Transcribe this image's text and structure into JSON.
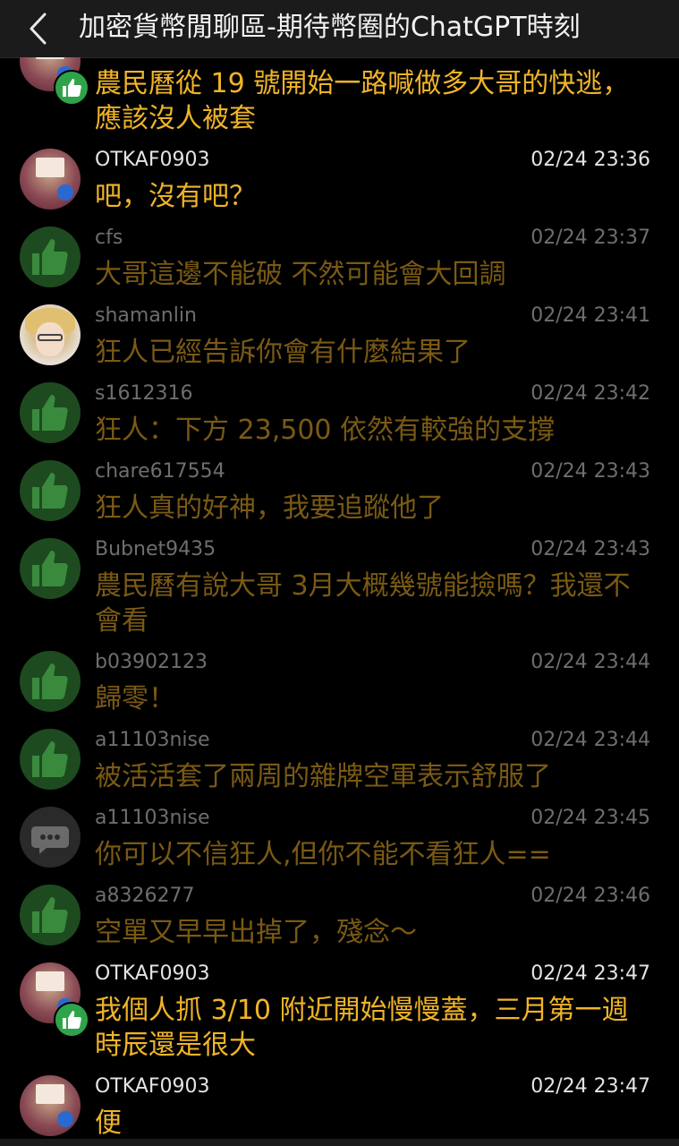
{
  "header": {
    "title": "加密貨幣閒聊區-期待幣圈的ChatGPT時刻",
    "back_icon": "chevron-left-icon"
  },
  "messages": [
    {
      "user": "",
      "time": "",
      "text": "農民曆從 19 號開始一路喊做多大哥的快逃，應該沒人被套",
      "avatar": "user-photo",
      "badge": "like-badge",
      "style": "bright"
    },
    {
      "user": "OTKAF0903",
      "time": "02/24 23:36",
      "text": "吧，沒有吧？",
      "avatar": "user-photo",
      "style": "bright"
    },
    {
      "user": "cfs",
      "time": "02/24 23:37",
      "text": "大哥這邊不能破 不然可能會大回調",
      "avatar": "like-icon",
      "style": "dim"
    },
    {
      "user": "shamanlin",
      "time": "02/24 23:41",
      "text": "狂人已經告訴你會有什麼結果了",
      "avatar": "user-photo",
      "style": "dim"
    },
    {
      "user": "s1612316",
      "time": "02/24 23:42",
      "text": "狂人：下方 23,500 依然有較強的支撐",
      "avatar": "like-icon",
      "style": "dim"
    },
    {
      "user": "chare617554",
      "time": "02/24 23:43",
      "text": "狂人真的好神，我要追蹤他了",
      "avatar": "like-icon",
      "style": "dim"
    },
    {
      "user": "Bubnet9435",
      "time": "02/24 23:43",
      "text": "農民曆有說大哥 3月大概幾號能撿嗎？我還不會看",
      "avatar": "like-icon",
      "style": "dim"
    },
    {
      "user": "b03902123",
      "time": "02/24 23:44",
      "text": "歸零！",
      "avatar": "like-icon",
      "style": "dim"
    },
    {
      "user": "a11103nise",
      "time": "02/24 23:44",
      "text": "被活活套了兩周的雜牌空軍表示舒服了",
      "avatar": "like-icon",
      "style": "dim"
    },
    {
      "user": "a11103nise",
      "time": "02/24 23:45",
      "text": "你可以不信狂人,但你不能不看狂人==",
      "avatar": "comment-icon",
      "style": "dim"
    },
    {
      "user": "a8326277",
      "time": "02/24 23:46",
      "text": "空單又早早出掉了，殘念～",
      "avatar": "like-icon",
      "style": "dim"
    },
    {
      "user": "OTKAF0903",
      "time": "02/24 23:47",
      "text": "我個人抓 3/10 附近開始慢慢蓋，三月第一週時辰還是很大",
      "avatar": "user-photo",
      "badge": "like-badge",
      "style": "bright"
    },
    {
      "user": "OTKAF0903",
      "time": "02/24 23:47",
      "text": "便",
      "avatar": "user-photo",
      "style": "bright"
    }
  ]
}
